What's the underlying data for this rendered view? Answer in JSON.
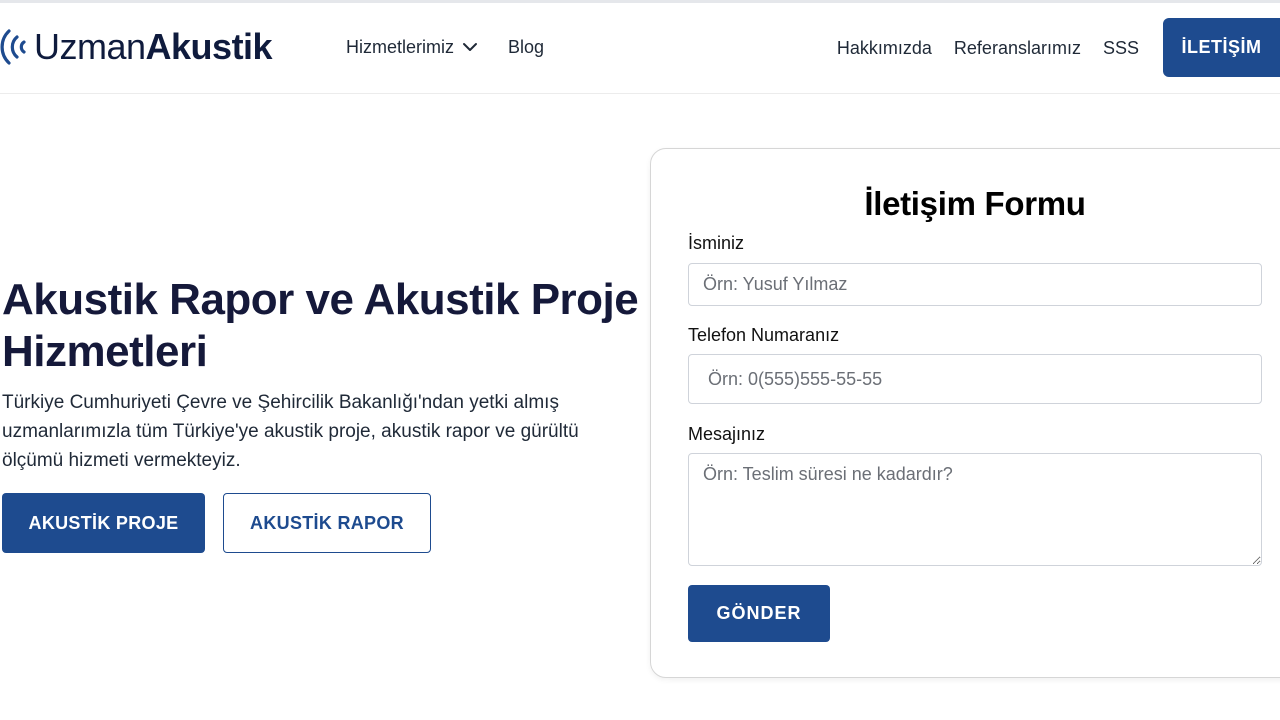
{
  "brand": {
    "logo_light": "Uzman",
    "logo_bold": "Akustik",
    "accent_color": "#1e4b8f",
    "logo_icon": "sound-waves-icon"
  },
  "nav": {
    "left": [
      {
        "label": "Hizmetlerimiz",
        "icon": "chevron-down-icon"
      },
      {
        "label": "Blog"
      }
    ],
    "right": [
      {
        "label": "Hakkımızda"
      },
      {
        "label": "Referanslarımız"
      },
      {
        "label": "SSS"
      }
    ],
    "cta_label": "İLETİŞİM"
  },
  "hero": {
    "title": "Akustik Rapor ve Akustik Proje Hizmetleri",
    "description": "Türkiye Cumhuriyeti Çevre ve Şehircilik Bakanlığı'ndan yetki almış uzmanlarımızla tüm Türkiye'ye akustik proje, akustik rapor ve gürültü ölçümü hizmeti vermekteyiz.",
    "primary_button": "AKUSTİK PROJE",
    "secondary_button": "AKUSTİK RAPOR"
  },
  "contact_form": {
    "title": "İletişim Formu",
    "name_label": "İsminiz",
    "name_placeholder": "Örn: Yusuf Yılmaz",
    "phone_label": "Telefon Numaranız",
    "phone_placeholder": "Örn: 0(555)555-55-55",
    "message_label": "Mesajınız",
    "message_placeholder": "Örn: Teslim süresi ne kadardır?",
    "submit_label": "GÖNDER"
  }
}
